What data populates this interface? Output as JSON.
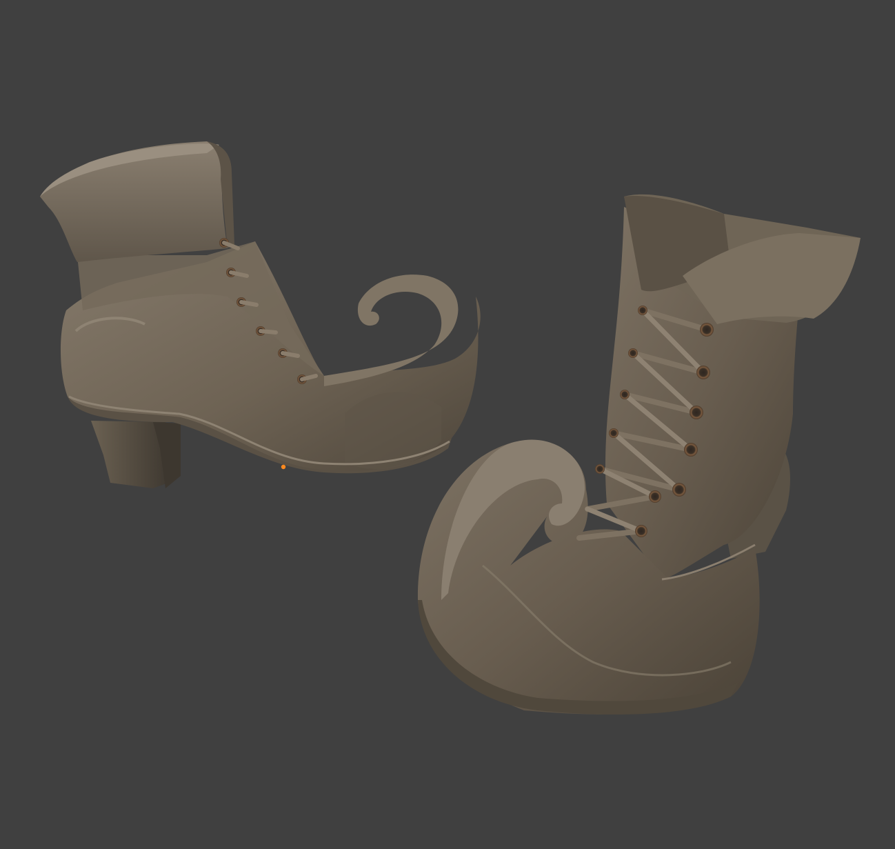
{
  "viewport": {
    "background_color": "#404040",
    "content": "3d-render"
  },
  "scene": {
    "objects": [
      {
        "name": "left-boot",
        "view": "side",
        "toe": "curled"
      },
      {
        "name": "right-boot",
        "view": "front-three-quarter",
        "toe": "curled"
      }
    ],
    "material": {
      "base_color": "#6e6354",
      "shadow_color": "#463f35",
      "highlight_color": "#8a7f70",
      "eyelet_color": "#6b4e36",
      "origin_marker_color": "#ff8a1f"
    }
  }
}
